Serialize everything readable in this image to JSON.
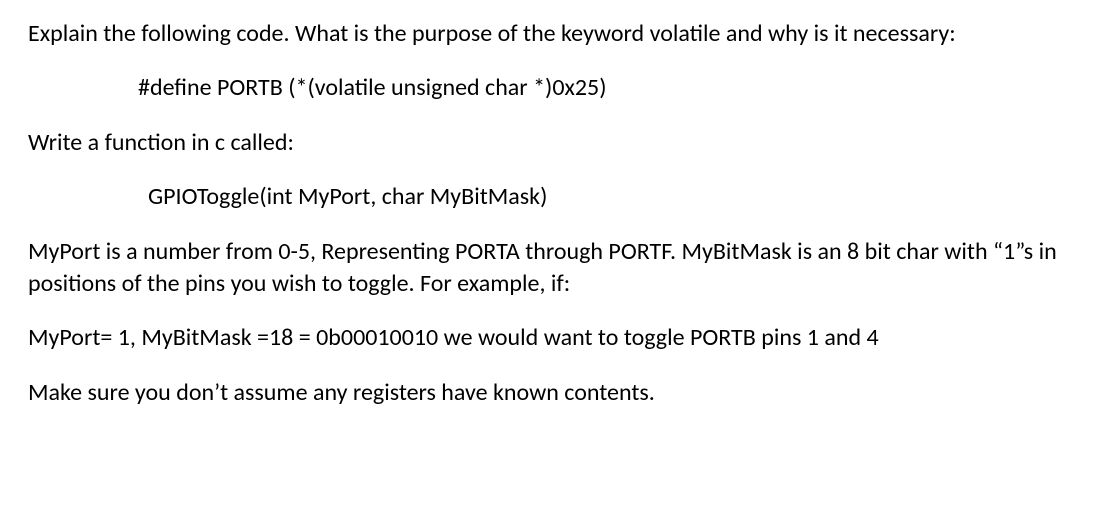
{
  "p1": "Explain the following code.  What is the purpose of the keyword volatile and why is it necessary:",
  "code1": "#define PORTB (*(volatile unsigned char *)0x25)",
  "p2": "Write a function in c called:",
  "code2": "GPIOToggle(int MyPort, char MyBitMask)",
  "p3": "MyPort is a number from 0-5, Representing PORTA through PORTF.  MyBitMask is an 8 bit char with “1”s in positions of the pins you wish to toggle.  For example, if:",
  "p4": "MyPort= 1, MyBitMask =18 = 0b00010010 we would want to toggle PORTB pins 1 and 4",
  "p5": "Make sure you don’t assume any registers have known contents."
}
